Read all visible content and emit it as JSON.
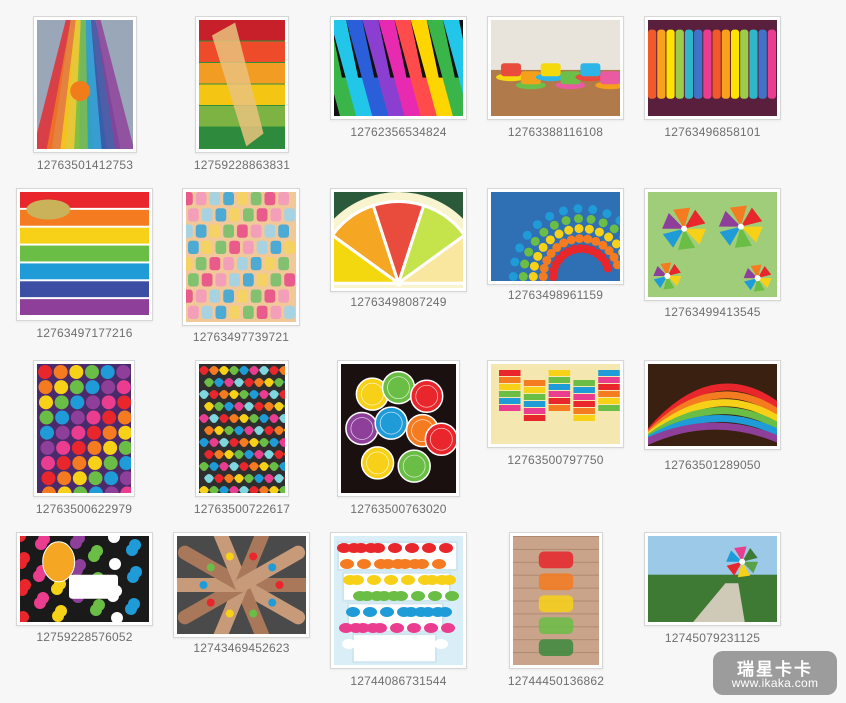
{
  "gallery": {
    "items": [
      {
        "caption": "12763501412753",
        "theme": "crayon-road"
      },
      {
        "caption": "12759228863831",
        "theme": "paintbrush-stripes"
      },
      {
        "caption": "12762356534824",
        "theme": "rainbow-piano"
      },
      {
        "caption": "12763388116108",
        "theme": "colored-cups"
      },
      {
        "caption": "12763496858101",
        "theme": "bangles"
      },
      {
        "caption": "12763497177216",
        "theme": "clay-layers"
      },
      {
        "caption": "12763497739721",
        "theme": "candy-blocks"
      },
      {
        "caption": "12763498087249",
        "theme": "citrus-slice"
      },
      {
        "caption": "12763498961159",
        "theme": "candy-arc"
      },
      {
        "caption": "12763499413545",
        "theme": "pinwheels"
      },
      {
        "caption": "12763500622979",
        "theme": "gumball-rows"
      },
      {
        "caption": "12763500722617",
        "theme": "mosaic-tiles"
      },
      {
        "caption": "12763500763020",
        "theme": "citrus-fruits"
      },
      {
        "caption": "12763500797750",
        "theme": "paper-lanterns"
      },
      {
        "caption": "12763501289050",
        "theme": "rainbow-shelves"
      },
      {
        "caption": "12759228576052",
        "theme": "birthday-balloons"
      },
      {
        "caption": "12743469452623",
        "theme": "bracelet-hands"
      },
      {
        "caption": "12744086731544",
        "theme": "candy-box"
      },
      {
        "caption": "12744450136862",
        "theme": "jars-wall"
      },
      {
        "caption": "12745079231125",
        "theme": "garden-pinwheel"
      }
    ]
  },
  "watermark": {
    "title": "瑞星卡卡",
    "url": "www.ikaka.com"
  }
}
